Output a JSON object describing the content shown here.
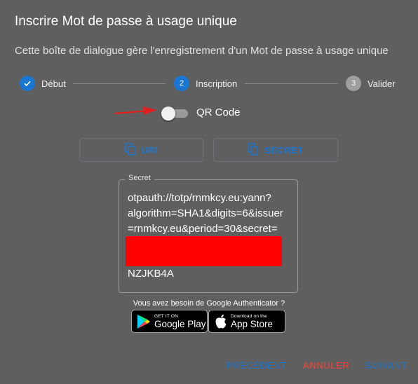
{
  "dialog": {
    "title": "Inscrire Mot de passe à usage unique",
    "description": "Cette boîte de dialogue gère l'enregistrement d'un Mot de passe à usage unique"
  },
  "stepper": {
    "steps": [
      {
        "label": "Début",
        "number": "1",
        "state": "completed"
      },
      {
        "label": "Inscription",
        "number": "2",
        "state": "active"
      },
      {
        "label": "Valider",
        "number": "3",
        "state": "inactive"
      }
    ]
  },
  "qr_toggle": {
    "label": "QR Code",
    "checked": false
  },
  "copy_buttons": {
    "uri_label": "URI",
    "secret_label": "SECRET"
  },
  "secret_field": {
    "legend": "Secret",
    "lines": [
      "otpauth://totp/rnmkcy.eu:yann?",
      "algorithm=SHA1&digits=6&issuer",
      "=rnmkcy.eu&period=30&secret=",
      "NZJKB4A"
    ]
  },
  "authenticator": {
    "prompt": "Vous avez besoin de Google Authenticator ?",
    "google_play": {
      "small": "GET IT ON",
      "big": "Google Play"
    },
    "app_store": {
      "small": "Download on the",
      "big": "App Store"
    }
  },
  "actions": {
    "previous": "PRÉCÉDENT",
    "cancel": "ANNULER",
    "next": "SUIVANT"
  },
  "colors": {
    "accent": "#1976d2",
    "danger": "#f44336",
    "background": "#5f5f5f",
    "redaction": "#ff0000",
    "annotation_arrow": "#e02020"
  }
}
